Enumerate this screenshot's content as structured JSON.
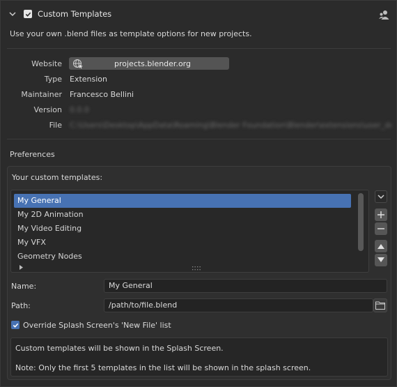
{
  "header": {
    "title": "Custom Templates",
    "enabled": true,
    "description": "Use your own .blend files as template options for new projects."
  },
  "meta": {
    "website_label": "Website",
    "website_value": "projects.blender.org",
    "type_label": "Type",
    "type_value": "Extension",
    "maintainer_label": "Maintainer",
    "maintainer_value": "Francesco Bellini",
    "version_label": "Version",
    "version_value": "0.0.0",
    "file_label": "File",
    "file_value": "C:\\Users\\Desktop\\AppData\\Roaming\\Blender Foundation\\Blender\\extensions\\user_default\\custom_templates\\__init__.py"
  },
  "preferences": {
    "heading": "Preferences",
    "list_label": "Your custom templates:",
    "templates": [
      "My General",
      "My 2D Animation",
      "My Video Editing",
      "My VFX",
      "Geometry Nodes"
    ],
    "selected_index": 0,
    "name_label": "Name:",
    "name_value": "My General",
    "path_label": "Path:",
    "path_value": "/path/to/file.blend",
    "override_label": "Override Splash Screen's 'New File' list",
    "override_checked": true,
    "info_line1": "Custom templates will be shown in the Splash Screen.",
    "info_line2": "Note: Only the first 5 templates in the list will be shown in the splash screen."
  },
  "colors": {
    "accent": "#4772b3",
    "panel": "#2b2b2b"
  }
}
